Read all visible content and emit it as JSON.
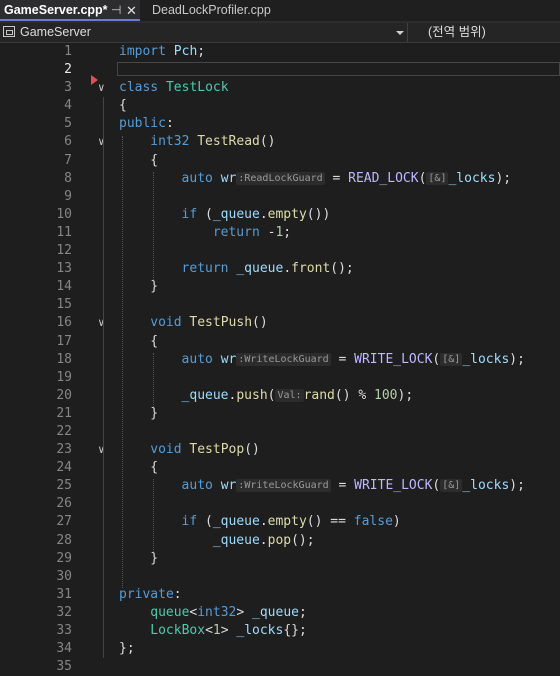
{
  "tabs": [
    {
      "title": "GameServer.cpp*",
      "active": true,
      "pin_icon": "pin-icon",
      "close_icon": "close-icon"
    },
    {
      "title": "DeadLockProfiler.cpp",
      "active": false
    }
  ],
  "navbar": {
    "project_scope": "GameServer",
    "member_scope": "(전역 범위)",
    "project_icon": "project-icon",
    "dropdown_icon": "chevron-down-icon"
  },
  "editor": {
    "current_line": 2,
    "lines": [
      {
        "num": "1",
        "text": "import Pch;"
      },
      {
        "num": "2",
        "text": ""
      },
      {
        "num": "3",
        "text": "class TestLock"
      },
      {
        "num": "4",
        "text": "{"
      },
      {
        "num": "5",
        "text": "public:"
      },
      {
        "num": "6",
        "text": "int32 TestRead()"
      },
      {
        "num": "7",
        "text": "{"
      },
      {
        "num": "8",
        "text": "auto wr = READ_LOCK(_locks);",
        "hints": [
          ":ReadLockGuard",
          "[&]"
        ]
      },
      {
        "num": "9",
        "text": ""
      },
      {
        "num": "10",
        "text": "if (_queue.empty())"
      },
      {
        "num": "11",
        "text": "return -1;"
      },
      {
        "num": "12",
        "text": ""
      },
      {
        "num": "13",
        "text": "return _queue.front();"
      },
      {
        "num": "14",
        "text": "}"
      },
      {
        "num": "15",
        "text": ""
      },
      {
        "num": "16",
        "text": "void TestPush()"
      },
      {
        "num": "17",
        "text": "{"
      },
      {
        "num": "18",
        "text": "auto wr = WRITE_LOCK(_locks);",
        "hints": [
          ":WriteLockGuard",
          "[&]"
        ]
      },
      {
        "num": "19",
        "text": ""
      },
      {
        "num": "20",
        "text": "_queue.push(rand() % 100);",
        "hints": [
          "Val:"
        ]
      },
      {
        "num": "21",
        "text": "}"
      },
      {
        "num": "22",
        "text": ""
      },
      {
        "num": "23",
        "text": "void TestPop()"
      },
      {
        "num": "24",
        "text": "{"
      },
      {
        "num": "25",
        "text": "auto wr = WRITE_LOCK(_locks);",
        "hints": [
          ":WriteLockGuard",
          "[&]"
        ]
      },
      {
        "num": "26",
        "text": ""
      },
      {
        "num": "27",
        "text": "if (_queue.empty() == false)"
      },
      {
        "num": "28",
        "text": "_queue.pop();"
      },
      {
        "num": "29",
        "text": "}"
      },
      {
        "num": "30",
        "text": ""
      },
      {
        "num": "31",
        "text": "private:"
      },
      {
        "num": "32",
        "text": "queue<int32> _queue;"
      },
      {
        "num": "33",
        "text": "LockBox<1> _locks{};"
      },
      {
        "num": "34",
        "text": "};"
      },
      {
        "num": "35",
        "text": ""
      }
    ],
    "colors": {
      "keyword": "#569cd6",
      "type": "#4ec9b0",
      "function": "#dcdcaa",
      "variable": "#9cdcfe",
      "number": "#b5cea8",
      "macro": "#beb7ff",
      "background": "#1e1e1e"
    }
  }
}
